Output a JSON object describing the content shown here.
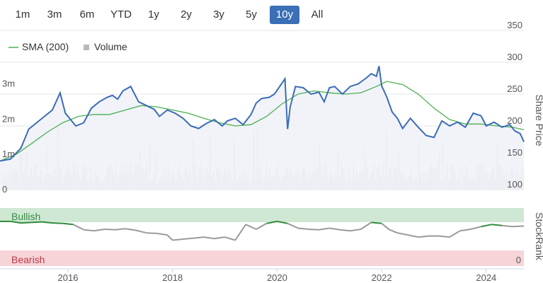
{
  "range_buttons": [
    {
      "label": "1m"
    },
    {
      "label": "3m"
    },
    {
      "label": "6m"
    },
    {
      "label": "YTD"
    },
    {
      "label": "1y"
    },
    {
      "label": "2y"
    },
    {
      "label": "3y"
    },
    {
      "label": "5y"
    },
    {
      "label": "10y",
      "active": true
    },
    {
      "label": "All"
    }
  ],
  "colors": {
    "price_line": "#3b6cb7",
    "price_fill": "#eef1f8",
    "sma_line": "#4caf50",
    "volume_bar": "#c8c8c8",
    "bullish_band": "#cfe8d4",
    "bearish_band": "#f6d4d8",
    "rank_bull": "#2e8b3a",
    "rank_neutral": "#9a9a9a",
    "active_button": "#3b6fb6"
  },
  "chart_data": [
    {
      "type": "line",
      "legend": [
        {
          "label": "SMA (200)",
          "icon": "line-swatch"
        },
        {
          "label": "Volume",
          "icon": "square-swatch"
        }
      ],
      "ylabel": "Share Price",
      "ylim": [
        100,
        350
      ],
      "yticks": [
        100,
        150,
        200,
        250,
        300,
        350
      ],
      "volume_ticks": [
        "0",
        "1m",
        "2m",
        "3m"
      ],
      "volume_max": 4500000,
      "x_ticks": [
        "2016",
        "2018",
        "2020",
        "2022",
        "2024"
      ],
      "x_tick_values": [
        2016,
        2018,
        2020,
        2022,
        2024
      ],
      "xlim": [
        2014.7,
        2024.72
      ],
      "series": [
        {
          "name": "Share Price",
          "x": [
            2014.7,
            2014.9,
            2015.1,
            2015.25,
            2015.4,
            2015.55,
            2015.7,
            2015.85,
            2015.95,
            2016.05,
            2016.15,
            2016.3,
            2016.45,
            2016.6,
            2016.75,
            2016.85,
            2016.95,
            2017.05,
            2017.2,
            2017.35,
            2017.5,
            2017.65,
            2017.75,
            2017.9,
            2018.05,
            2018.2,
            2018.35,
            2018.5,
            2018.65,
            2018.8,
            2018.95,
            2019.05,
            2019.2,
            2019.35,
            2019.5,
            2019.6,
            2019.7,
            2019.85,
            2019.95,
            2020.05,
            2020.15,
            2020.2,
            2020.25,
            2020.35,
            2020.5,
            2020.65,
            2020.8,
            2020.9,
            2021.0,
            2021.1,
            2021.25,
            2021.4,
            2021.55,
            2021.7,
            2021.8,
            2021.9,
            2021.95,
            2022.0,
            2022.1,
            2022.2,
            2022.3,
            2022.4,
            2022.55,
            2022.7,
            2022.85,
            2023.0,
            2023.15,
            2023.3,
            2023.45,
            2023.6,
            2023.75,
            2023.9,
            2024.0,
            2024.15,
            2024.3,
            2024.45,
            2024.55,
            2024.65,
            2024.72
          ],
          "values": [
            145,
            148,
            165,
            195,
            205,
            215,
            225,
            252,
            220,
            210,
            200,
            205,
            228,
            238,
            245,
            248,
            242,
            255,
            262,
            238,
            232,
            226,
            215,
            225,
            220,
            212,
            200,
            196,
            204,
            210,
            200,
            208,
            212,
            202,
            218,
            236,
            243,
            245,
            250,
            262,
            274,
            195,
            230,
            262,
            260,
            250,
            253,
            238,
            260,
            262,
            250,
            262,
            266,
            275,
            282,
            278,
            294,
            263,
            245,
            222,
            212,
            196,
            212,
            198,
            185,
            182,
            208,
            200,
            206,
            198,
            220,
            216,
            200,
            206,
            198,
            202,
            192,
            188,
            175
          ]
        },
        {
          "name": "SMA (200)",
          "x": [
            2014.7,
            2015.0,
            2015.3,
            2015.6,
            2015.9,
            2016.2,
            2016.5,
            2016.8,
            2017.1,
            2017.4,
            2017.7,
            2018.0,
            2018.3,
            2018.6,
            2018.9,
            2019.2,
            2019.5,
            2019.8,
            2020.1,
            2020.4,
            2020.7,
            2021.0,
            2021.3,
            2021.6,
            2021.9,
            2022.1,
            2022.4,
            2022.7,
            2023.0,
            2023.3,
            2023.6,
            2023.9,
            2024.2,
            2024.5,
            2024.72
          ],
          "values": [
            145,
            155,
            172,
            190,
            205,
            215,
            218,
            218,
            225,
            232,
            230,
            225,
            220,
            212,
            205,
            200,
            202,
            215,
            235,
            250,
            255,
            252,
            250,
            252,
            262,
            270,
            265,
            250,
            228,
            210,
            203,
            203,
            200,
            198,
            194
          ]
        }
      ]
    },
    {
      "type": "line",
      "ylabel": "StockRank",
      "bands": [
        {
          "label": "Bullish"
        },
        {
          "label": "Bearish"
        }
      ],
      "ytick_bottom": "0",
      "ylim": [
        0,
        100
      ],
      "bull_threshold": 80,
      "series": [
        {
          "name": "StockRank",
          "x": [
            2014.7,
            2014.9,
            2015.1,
            2015.3,
            2015.5,
            2015.7,
            2015.9,
            2016.1,
            2016.3,
            2016.5,
            2016.7,
            2016.9,
            2017.1,
            2017.3,
            2017.5,
            2017.7,
            2017.9,
            2018.0,
            2018.2,
            2018.4,
            2018.6,
            2018.8,
            2019.0,
            2019.2,
            2019.4,
            2019.6,
            2019.8,
            2020.0,
            2020.2,
            2020.4,
            2020.6,
            2020.8,
            2021.0,
            2021.2,
            2021.4,
            2021.6,
            2021.8,
            2022.0,
            2022.15,
            2022.3,
            2022.5,
            2022.7,
            2022.9,
            2023.1,
            2023.3,
            2023.5,
            2023.7,
            2023.9,
            2024.1,
            2024.3,
            2024.5,
            2024.72
          ],
          "values": [
            88,
            88,
            85,
            86,
            87,
            85,
            84,
            82,
            72,
            70,
            73,
            72,
            74,
            71,
            66,
            65,
            62,
            52,
            54,
            56,
            58,
            55,
            58,
            52,
            82,
            73,
            84,
            88,
            84,
            75,
            73,
            72,
            75,
            72,
            70,
            73,
            86,
            84,
            72,
            66,
            62,
            58,
            60,
            60,
            58,
            70,
            73,
            78,
            82,
            80,
            78,
            79
          ]
        }
      ]
    }
  ]
}
